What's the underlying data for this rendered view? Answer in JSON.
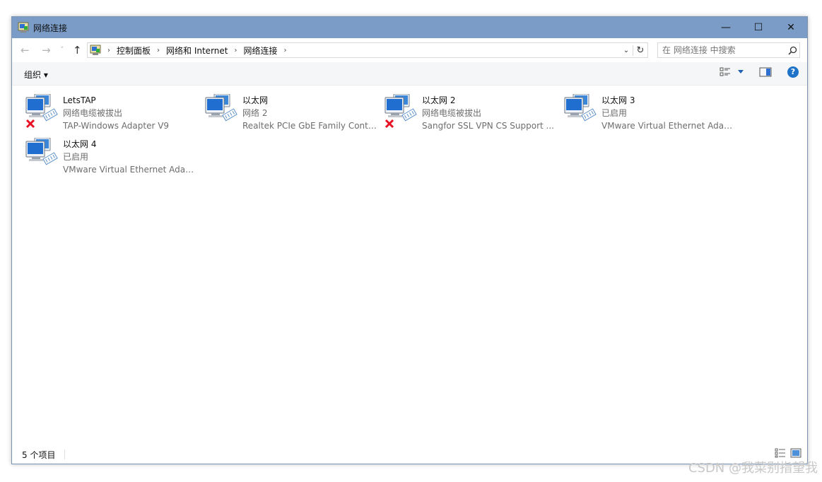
{
  "window": {
    "title": "网络连接",
    "minimize": "—",
    "maximize": "☐",
    "close": "✕"
  },
  "nav": {
    "back": "←",
    "forward": "→",
    "recent": "˅",
    "up": "↑"
  },
  "address": {
    "breadcrumbs": [
      "控制面板",
      "网络和 Internet",
      "网络连接"
    ],
    "dropdown": "⌄",
    "refresh": "↻"
  },
  "search": {
    "placeholder": "在 网络连接 中搜索"
  },
  "toolbar": {
    "organize": "组织 ▾",
    "help": "?"
  },
  "connections": [
    {
      "name": "LetsTAP",
      "status": "网络电缆被拔出",
      "adapter": "TAP-Windows Adapter V9",
      "disconnected": true
    },
    {
      "name": "以太网",
      "status": "网络 2",
      "adapter": "Realtek PCIe GbE Family Contr...",
      "disconnected": false
    },
    {
      "name": "以太网 2",
      "status": "网络电缆被拔出",
      "adapter": "Sangfor SSL VPN CS Support ...",
      "disconnected": true
    },
    {
      "name": "以太网 3",
      "status": "已启用",
      "adapter": "VMware Virtual Ethernet Adap...",
      "disconnected": false
    },
    {
      "name": "以太网 4",
      "status": "已启用",
      "adapter": "VMware Virtual Ethernet Adap...",
      "disconnected": false
    }
  ],
  "status_bar": {
    "item_count": "5 个项目"
  },
  "watermark": "CSDN @我菜别指望我",
  "colors": {
    "titlebar": "#7a9cc6",
    "error_x": "#e81123",
    "help_blue": "#1e73c8"
  }
}
